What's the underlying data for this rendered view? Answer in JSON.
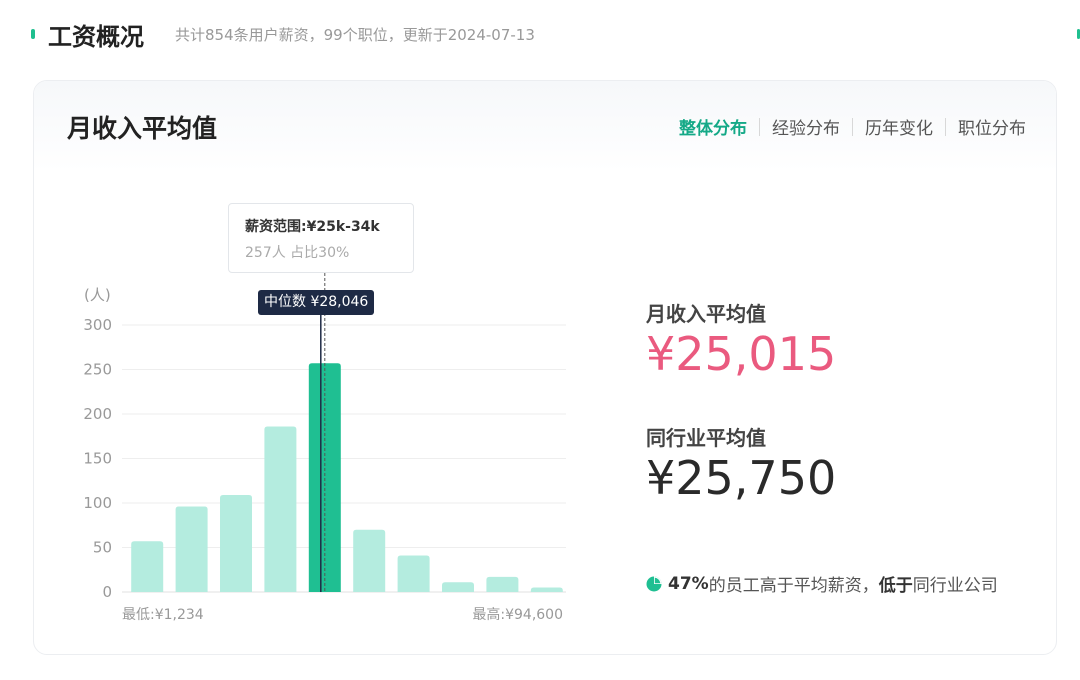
{
  "header": {
    "title": "工资概况",
    "subtitle": "共计854条用户薪资，99个职位，更新于2024-07-13"
  },
  "card": {
    "title": "月收入平均值",
    "tabs": [
      {
        "label": "整体分布",
        "active": true
      },
      {
        "label": "经验分布",
        "active": false
      },
      {
        "label": "历年变化",
        "active": false
      },
      {
        "label": "职位分布",
        "active": false
      }
    ]
  },
  "tooltip": {
    "range": "薪资范围:¥25k-34k",
    "detail": "257人  占比30%"
  },
  "median": {
    "label": "中位数 ¥28,046"
  },
  "chart_data": {
    "type": "bar",
    "y_unit_label": "(人)",
    "ylim": [
      0,
      300
    ],
    "yticks": [
      0,
      50,
      100,
      150,
      200,
      250,
      300
    ],
    "values": [
      57,
      96,
      109,
      186,
      257,
      70,
      41,
      11,
      17,
      5
    ],
    "highlight_index": 4,
    "min_label": "最低:¥1,234",
    "max_label": "最高:¥94,600",
    "grid": true,
    "colors": {
      "bar": "#b4ecdf",
      "highlight": "#1fbf92",
      "grid": "#eeeeee"
    }
  },
  "stats": {
    "avg_label": "月收入平均值",
    "avg_value": "¥25,015",
    "industry_label": "同行业平均值",
    "industry_value": "¥25,750",
    "summary_pct": "47%",
    "summary_mid": "的员工高于平均薪资，",
    "summary_bold": "低于",
    "summary_tail": "同行业公司"
  }
}
